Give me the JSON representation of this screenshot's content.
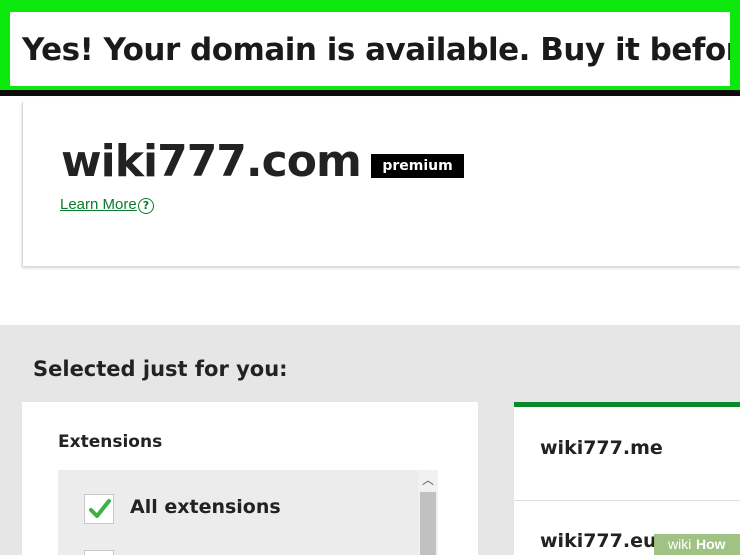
{
  "banner": {
    "text": "Yes! Your domain is available. Buy it before"
  },
  "domain": {
    "name": "wiki777.com",
    "badge": "premium",
    "learn_more": "Learn More",
    "help_icon": "?"
  },
  "suggestions": {
    "title": "Selected just for you:",
    "extensions": {
      "heading": "Extensions",
      "items": [
        {
          "label": "All extensions",
          "checked": true
        }
      ],
      "scroll_up_icon": "chevron-up-icon"
    },
    "results": [
      {
        "domain": "wiki777.me"
      },
      {
        "domain": "wiki777.eu"
      }
    ],
    "accent_color": "#0a8a2a"
  },
  "colors": {
    "highlight": "#0be80b",
    "link": "#0a7a2e"
  },
  "watermark": {
    "part1": "wiki",
    "part2": "How"
  }
}
